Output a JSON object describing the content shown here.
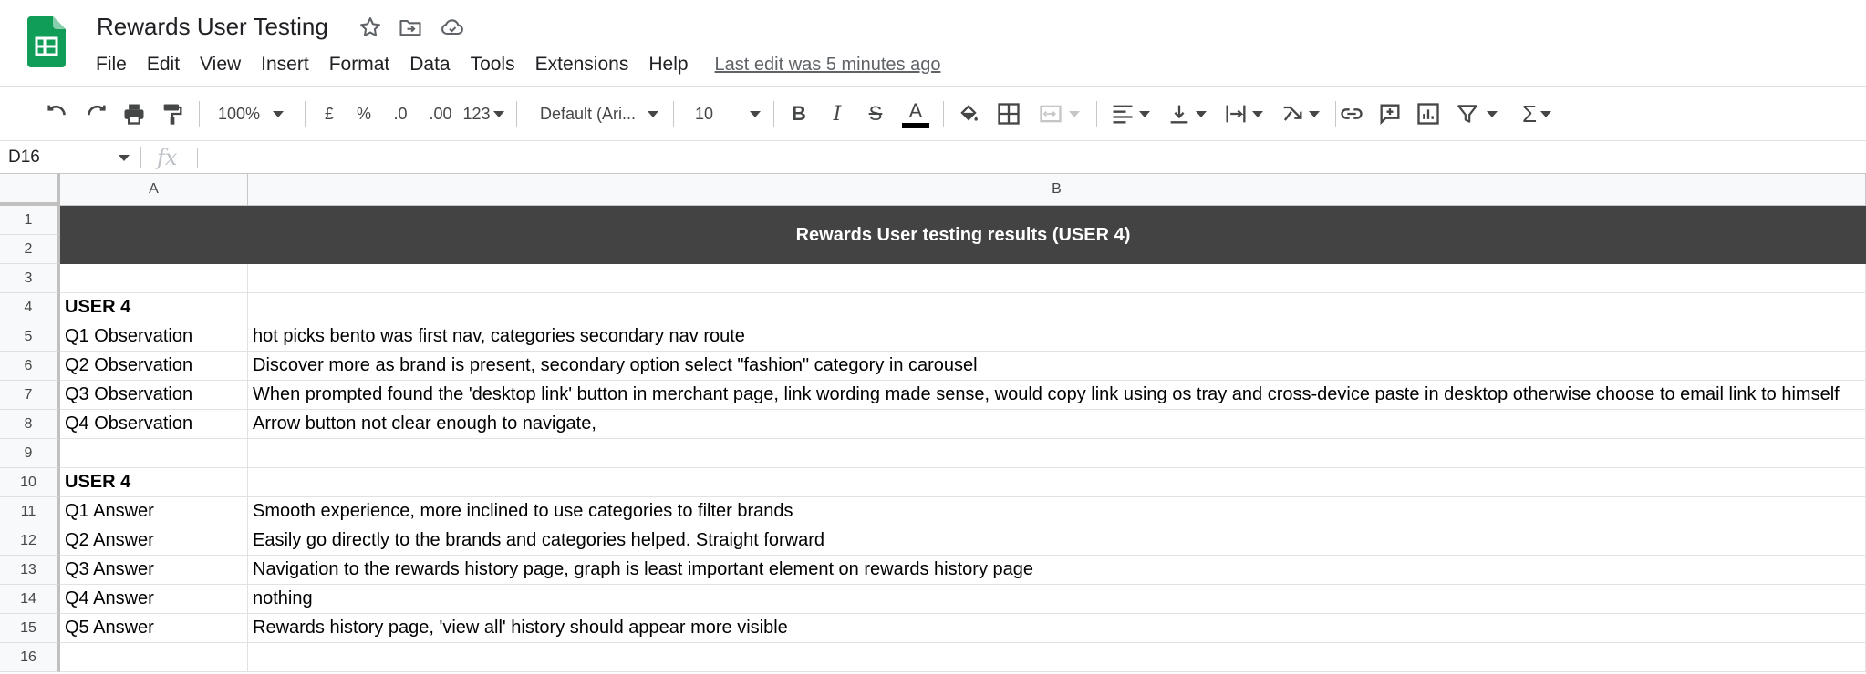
{
  "app": {
    "title": "Rewards User Testing",
    "last_edit": "Last edit was 5 minutes ago",
    "brand_color": "#0F9D58"
  },
  "menu": [
    "File",
    "Edit",
    "View",
    "Insert",
    "Format",
    "Data",
    "Tools",
    "Extensions",
    "Help"
  ],
  "toolbar": {
    "zoom": "100%",
    "currency": "£",
    "percent": "%",
    "decrease_decimal": ".0",
    "increase_decimal": ".00",
    "more_formats": "123",
    "font": "Default (Ari...",
    "font_size": "10",
    "bold": "B",
    "italic": "I",
    "strikethrough": "S",
    "text_color": "A"
  },
  "formula_bar": {
    "cell_ref": "D16",
    "fx": "fx",
    "value": ""
  },
  "grid": {
    "columns": [
      "A",
      "B"
    ],
    "row_numbers": [
      "1",
      "2",
      "3",
      "4",
      "5",
      "6",
      "7",
      "8",
      "9",
      "10",
      "11",
      "12",
      "13",
      "14",
      "15",
      "16"
    ],
    "banner": "Rewards User testing results (USER 4)",
    "rows": [
      {
        "a": "",
        "b": ""
      },
      {
        "a": "USER 4",
        "b": ""
      },
      {
        "a": "Q1 Observation",
        "b": "hot picks bento was first nav, categories secondary nav route"
      },
      {
        "a": "Q2 Observation",
        "b": "Discover more as brand is present, secondary option select \"fashion\" category in carousel"
      },
      {
        "a": "Q3 Observation",
        "b": "When prompted found the 'desktop link' button in merchant page, link wording made sense, would copy link using os tray and cross-device paste in desktop otherwise choose to email link to himself"
      },
      {
        "a": "Q4 Observation",
        "b": "Arrow button not clear enough to navigate,"
      },
      {
        "a": "",
        "b": ""
      },
      {
        "a": "USER 4",
        "b": ""
      },
      {
        "a": "Q1 Answer",
        "b": "Smooth experience, more inclined to use categories to filter brands"
      },
      {
        "a": "Q2 Answer",
        "b": "Easily go directly to the brands and categories helped. Straight forward"
      },
      {
        "a": "Q3 Answer",
        "b": "Navigation to the rewards history page, graph is least important element on rewards history page"
      },
      {
        "a": "Q4 Answer",
        "b": "nothing"
      },
      {
        "a": "Q5 Answer",
        "b": "Rewards history page, 'view all' history should appear more visible"
      },
      {
        "a": "",
        "b": ""
      }
    ],
    "banner_color": "#434343"
  }
}
